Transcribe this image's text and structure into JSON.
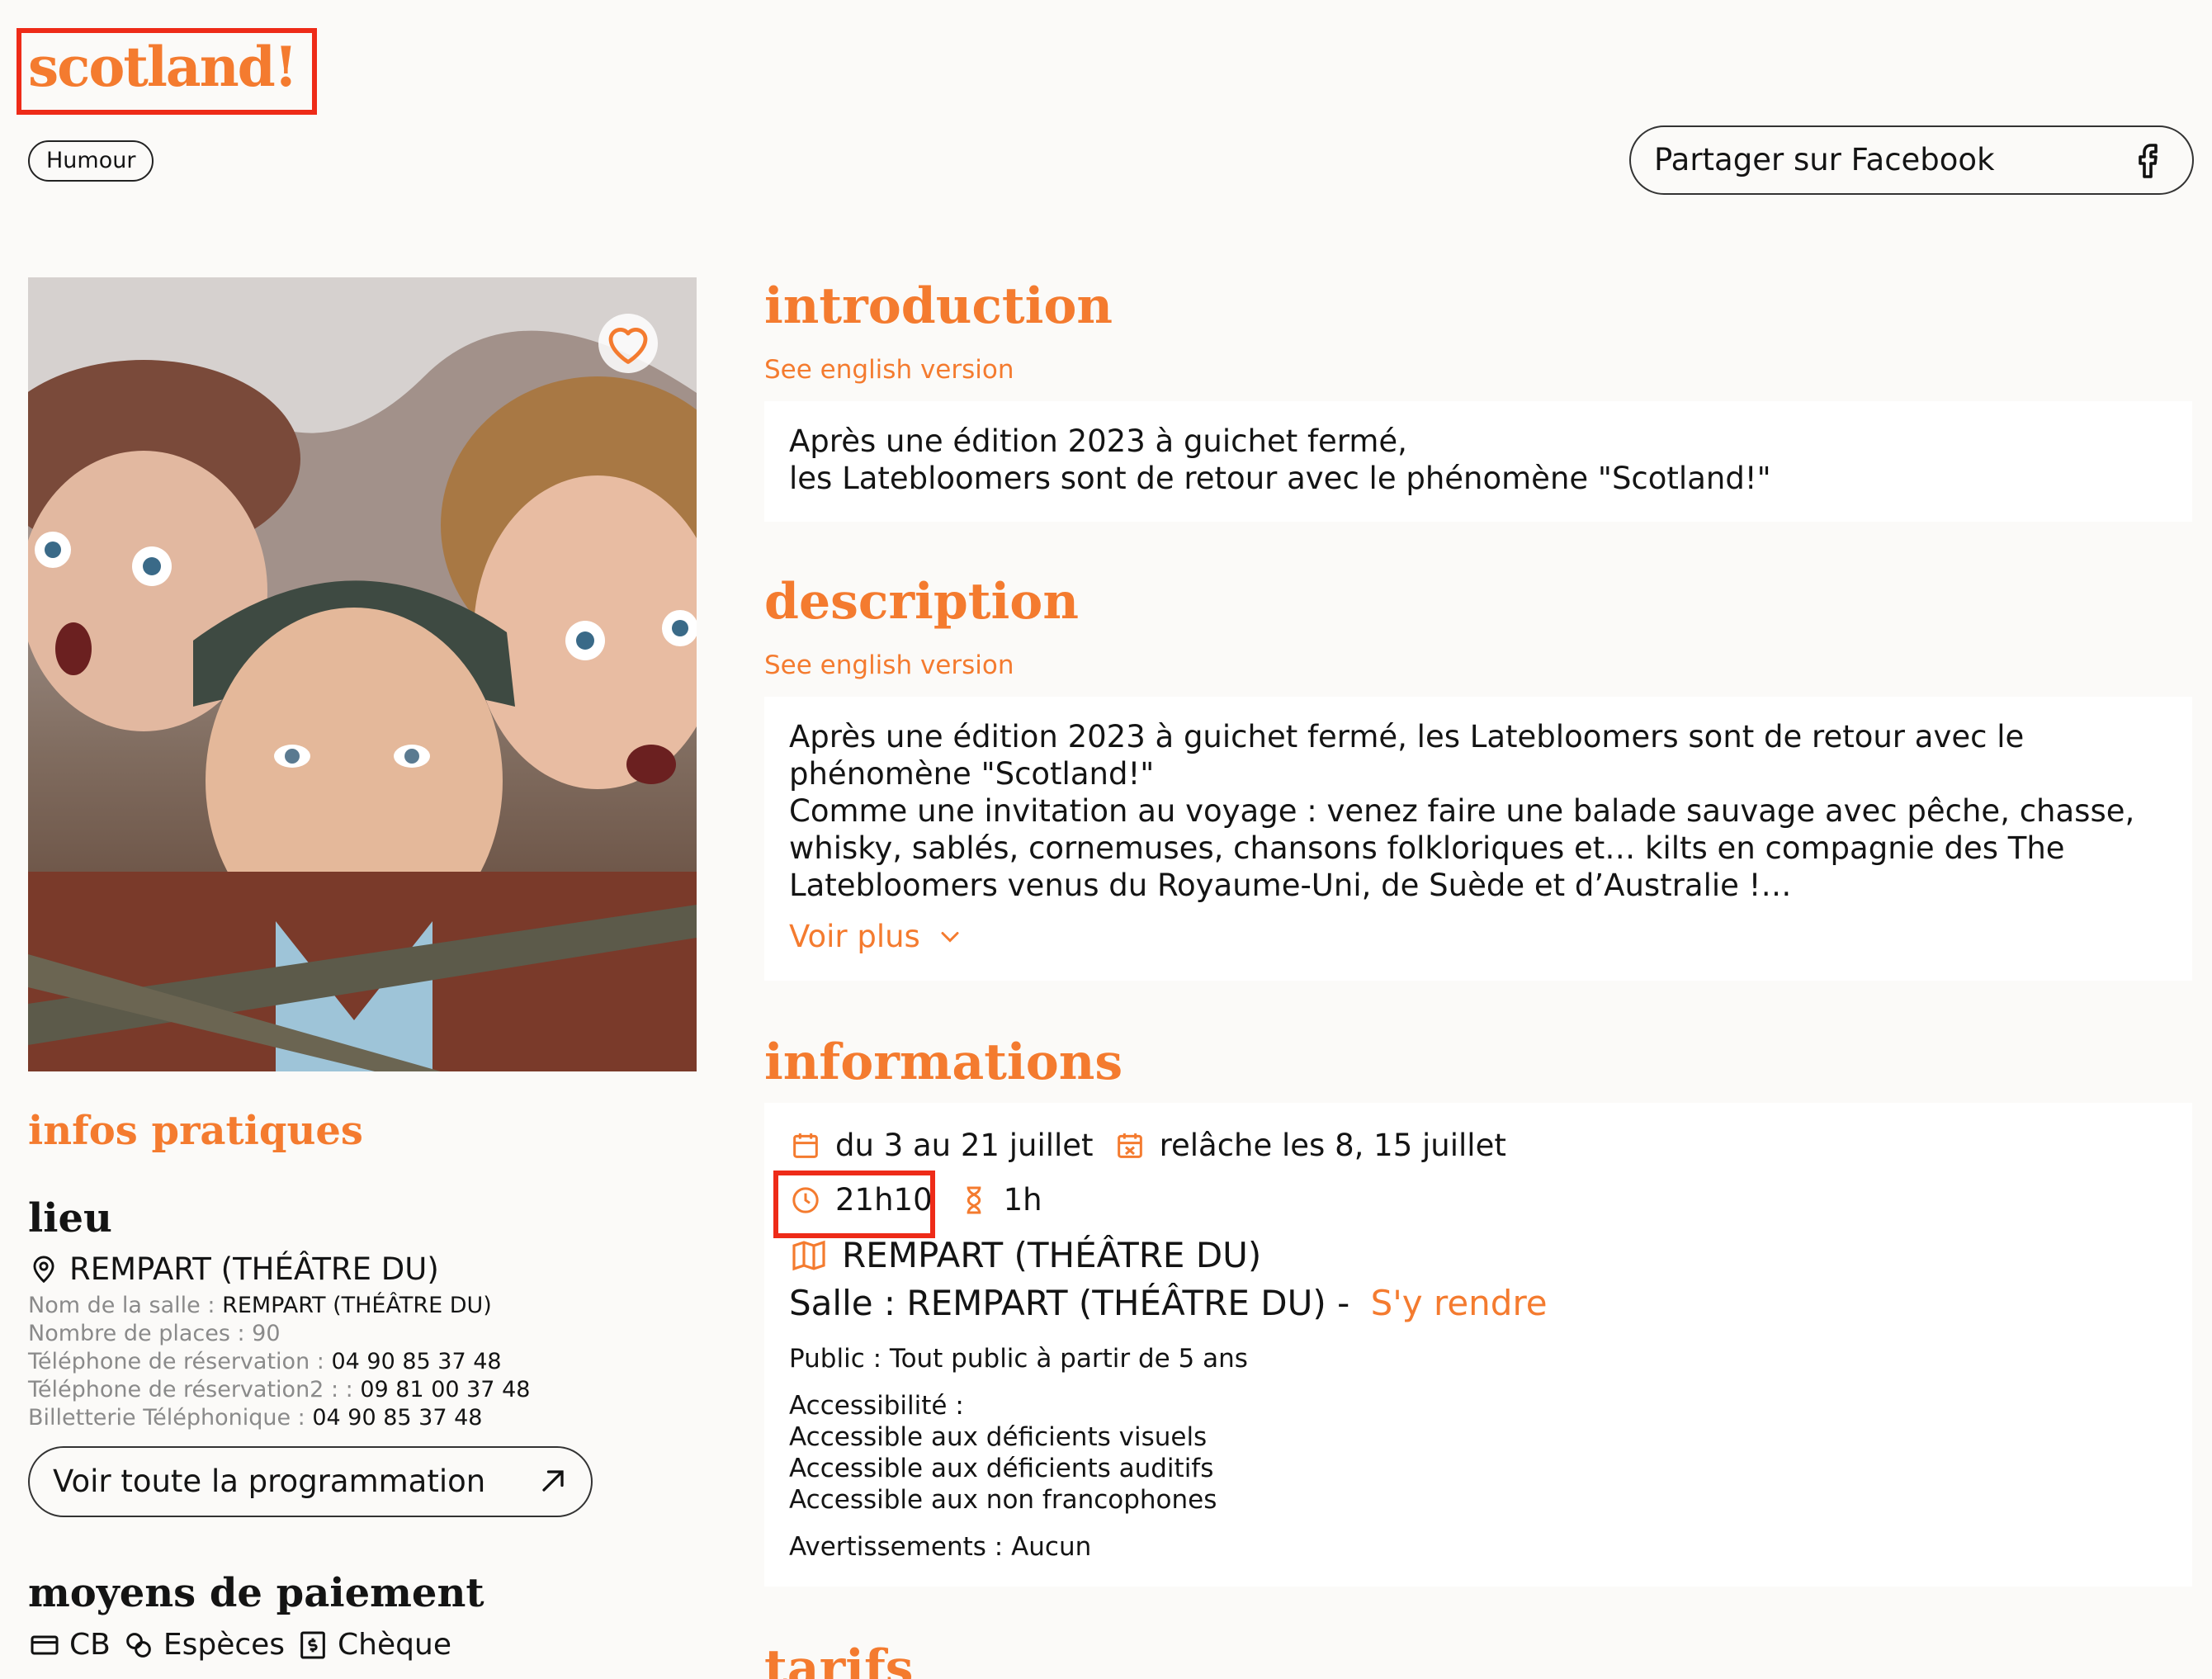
{
  "header": {
    "title": "scotland!",
    "tag": "Humour",
    "share_label": "Partager sur Facebook"
  },
  "icons": {
    "facebook": "facebook-icon",
    "heart": "heart-icon",
    "pin": "map-pin-icon",
    "arrow": "arrow-up-right-icon",
    "card": "credit-card-icon",
    "coins": "coins-icon",
    "cheque": "cheque-icon",
    "calendar": "calendar-icon",
    "calendar_off": "calendar-off-icon",
    "clock": "clock-icon",
    "hourglass": "hourglass-icon",
    "map": "map-icon",
    "chevron": "chevron-down-icon"
  },
  "colors": {
    "accent": "#f47b2f",
    "highlight": "#ee2b18"
  },
  "left": {
    "infos_title": "infos pratiques",
    "lieu_title": "lieu",
    "venue": "REMPART (THÉÂTRE DU)",
    "details": [
      {
        "label": "Nom de la salle : ",
        "value": "REMPART (THÉÂTRE DU)"
      },
      {
        "label": "Nombre de places : 90",
        "value": ""
      },
      {
        "label": "Téléphone de réservation : ",
        "value": "04 90 85 37 48"
      },
      {
        "label": "Téléphone de réservation2 : : ",
        "value": "09 81 00 37 48"
      },
      {
        "label": "Billetterie Téléphonique : ",
        "value": "04 90 85 37 48"
      }
    ],
    "programme_button": "Voir toute la programmation",
    "payment_title": "moyens de paiement",
    "payments": [
      "CB",
      "Espèces",
      "Chèque"
    ]
  },
  "introduction": {
    "title": "introduction",
    "see_english": "See english version",
    "lines": [
      "Après une édition 2023 à guichet fermé,",
      "les Latebloomers sont de retour avec le phénomène \"Scotland!\""
    ]
  },
  "description": {
    "title": "description",
    "see_english": "See english version",
    "lines": [
      "Après une édition 2023 à guichet fermé, les Latebloomers sont de retour avec le",
      "phénomène \"Scotland!\"",
      "Comme une invitation au voyage : venez faire une balade sauvage avec pêche, chasse,",
      "whisky, sablés, cornemuses, chansons folkloriques et… kilts en compagnie des The",
      "Latebloomers venus du Royaume-Uni, de Suède et d’Australie !…"
    ],
    "voir_plus": "Voir plus"
  },
  "informations": {
    "title": "informations",
    "dates": "du 3 au 21 juillet",
    "relache": "relâche les 8, 15 juillet",
    "time": "21h10",
    "duration": "1h",
    "venue": "REMPART (THÉÂTRE DU)",
    "salle": "Salle : REMPART (THÉÂTRE DU) - ",
    "sy_rendre": "S'y rendre",
    "public": "Public : Tout public à partir de 5 ans",
    "accessibilite": [
      "Accessibilité :",
      "Accessible aux déficients visuels",
      "Accessible aux déficients auditifs",
      "Accessible aux non francophones"
    ],
    "avertissements": "Avertissements : Aucun"
  },
  "tarifs": {
    "title": "tarifs"
  }
}
